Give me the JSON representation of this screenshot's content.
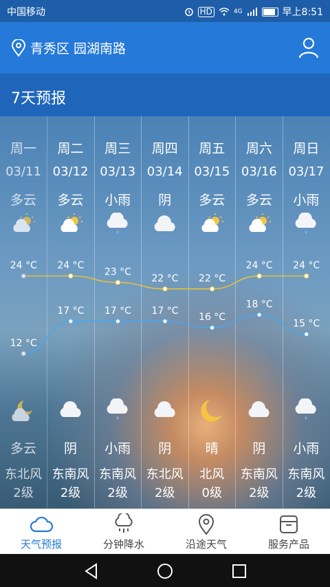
{
  "status_bar": {
    "carrier": "中国移动",
    "hd": "HD",
    "net": "4G",
    "time": "早上8:51"
  },
  "header": {
    "location": "青秀区 园湖南路",
    "user_icon": "user-icon",
    "location_icon": "location-pin-icon"
  },
  "section": {
    "title": "7天预报"
  },
  "days": [
    {
      "day": "周一",
      "date": "03/11",
      "day_cond": "多云",
      "day_icon": "partly-cloudy-icon",
      "high": "24 °C",
      "low": "12 °C",
      "night_icon": "moon-cloud-icon",
      "night_cond": "多云",
      "wind_dir": "东北风",
      "wind_level": "2级"
    },
    {
      "day": "周二",
      "date": "03/12",
      "day_cond": "多云",
      "day_icon": "partly-cloudy-icon",
      "high": "24 °C",
      "low": "17 °C",
      "night_icon": "cloud-icon",
      "night_cond": "阴",
      "wind_dir": "东南风",
      "wind_level": "2级"
    },
    {
      "day": "周三",
      "date": "03/13",
      "day_cond": "小雨",
      "day_icon": "light-rain-icon",
      "high": "23 °C",
      "low": "17 °C",
      "night_icon": "light-rain-icon",
      "night_cond": "小雨",
      "wind_dir": "东南风",
      "wind_level": "2级"
    },
    {
      "day": "周四",
      "date": "03/14",
      "day_cond": "阴",
      "day_icon": "cloud-icon",
      "high": "22 °C",
      "low": "17 °C",
      "night_icon": "cloud-icon",
      "night_cond": "阴",
      "wind_dir": "东北风",
      "wind_level": "2级"
    },
    {
      "day": "周五",
      "date": "03/15",
      "day_cond": "多云",
      "day_icon": "partly-cloudy-icon",
      "high": "22 °C",
      "low": "16 °C",
      "night_icon": "moon-icon",
      "night_cond": "晴",
      "wind_dir": "北风",
      "wind_level": "0级"
    },
    {
      "day": "周六",
      "date": "03/16",
      "day_cond": "多云",
      "day_icon": "partly-cloudy-icon",
      "high": "24 °C",
      "low": "18 °C",
      "night_icon": "cloud-icon",
      "night_cond": "阴",
      "wind_dir": "东南风",
      "wind_level": "2级"
    },
    {
      "day": "周日",
      "date": "03/17",
      "day_cond": "小雨",
      "day_icon": "light-rain-icon",
      "high": "24 °C",
      "low": "15 °C",
      "night_icon": "light-rain-icon",
      "night_cond": "小雨",
      "wind_dir": "东南风",
      "wind_level": "2级"
    }
  ],
  "temps": {
    "high": [
      24,
      24,
      23,
      22,
      22,
      24,
      24
    ],
    "low": [
      12,
      17,
      17,
      17,
      16,
      18,
      15
    ],
    "high_color": "#e8c03a",
    "low_color": "#4aa6ee"
  },
  "bottom_nav": [
    {
      "label": "天气预报",
      "icon": "cloud-outline-icon",
      "active": true
    },
    {
      "label": "分钟降水",
      "icon": "rain-cloud-icon",
      "active": false
    },
    {
      "label": "沿途天气",
      "icon": "location-pin-icon",
      "active": false
    },
    {
      "label": "服务产品",
      "icon": "box-icon",
      "active": false
    }
  ],
  "colors": {
    "accent": "#2579d8",
    "header_bg": "#1f66bb"
  }
}
